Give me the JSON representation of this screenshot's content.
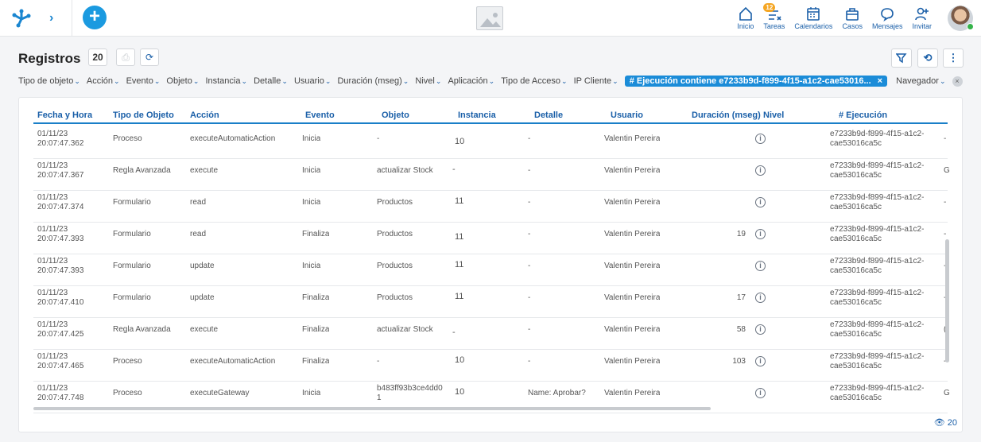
{
  "topbar": {
    "nav_items": [
      {
        "label": "Inicio",
        "icon": "home-icon"
      },
      {
        "label": "Tareas",
        "icon": "tasks-icon",
        "badge": "12"
      },
      {
        "label": "Calendarios",
        "icon": "calendar-icon"
      },
      {
        "label": "Casos",
        "icon": "briefcase-icon"
      },
      {
        "label": "Mensajes",
        "icon": "chat-icon"
      },
      {
        "label": "Invitar",
        "icon": "invite-user-icon"
      }
    ]
  },
  "page": {
    "title": "Registros",
    "count": "20",
    "footer_count": "20"
  },
  "filters": {
    "items": [
      "Tipo de objeto",
      "Acción",
      "Evento",
      "Objeto",
      "Instancia",
      "Detalle",
      "Usuario",
      "Duración (mseg)",
      "Nivel",
      "Aplicación",
      "Tipo de Acceso",
      "IP Cliente"
    ],
    "active_chip": "# Ejecución contiene e7233b9d-f899-4f15-a1c2-cae53016...",
    "after_chip": "Navegador"
  },
  "table": {
    "columns": [
      "Fecha y Hora",
      "Tipo de Objeto",
      "Acción",
      "Evento",
      "Objeto",
      "Instancia",
      "Detalle",
      "Usuario",
      "Duración (mseg)",
      "Nivel",
      "# Ejecución"
    ],
    "rows": [
      {
        "date": "01/11/23",
        "time": "20:07:47.362",
        "tipo": "Proceso",
        "accion": "executeAutomaticAction",
        "evento": "Inicia",
        "objeto": "-",
        "objeto2": "",
        "instancia": "10",
        "detalle": "-",
        "usuario": "Valentin Pereira",
        "duracion": "",
        "ejec1": "e7233b9d-f899-4f15-a1c2-",
        "ejec2": "cae53016ca5c",
        "extra": "-"
      },
      {
        "date": "01/11/23",
        "time": "20:07:47.367",
        "tipo": "Regla Avanzada",
        "accion": "execute",
        "evento": "Inicia",
        "objeto": "actualizar Stock",
        "objeto2": "",
        "instancia": "-",
        "detalle": "-",
        "usuario": "Valentin Pereira",
        "duracion": "",
        "ejec1": "e7233b9d-f899-4f15-a1c2-",
        "ejec2": "cae53016ca5c",
        "extra": "G"
      },
      {
        "date": "01/11/23",
        "time": "20:07:47.374",
        "tipo": "Formulario",
        "accion": "read",
        "evento": "Inicia",
        "objeto": "Productos",
        "objeto2": "",
        "instancia": "11",
        "detalle": "-",
        "usuario": "Valentin Pereira",
        "duracion": "",
        "ejec1": "e7233b9d-f899-4f15-a1c2-",
        "ejec2": "cae53016ca5c",
        "extra": "-"
      },
      {
        "date": "01/11/23",
        "time": "20:07:47.393",
        "tipo": "Formulario",
        "accion": "read",
        "evento": "Finaliza",
        "objeto": "Productos",
        "objeto2": "",
        "instancia": "11",
        "detalle": "-",
        "usuario": "Valentin Pereira",
        "duracion": "19",
        "ejec1": "e7233b9d-f899-4f15-a1c2-",
        "ejec2": "cae53016ca5c",
        "extra": "-"
      },
      {
        "date": "01/11/23",
        "time": "20:07:47.393",
        "tipo": "Formulario",
        "accion": "update",
        "evento": "Inicia",
        "objeto": "Productos",
        "objeto2": "",
        "instancia": "11",
        "detalle": "-",
        "usuario": "Valentin Pereira",
        "duracion": "",
        "ejec1": "e7233b9d-f899-4f15-a1c2-",
        "ejec2": "cae53016ca5c",
        "extra": "-"
      },
      {
        "date": "01/11/23",
        "time": "20:07:47.410",
        "tipo": "Formulario",
        "accion": "update",
        "evento": "Finaliza",
        "objeto": "Productos",
        "objeto2": "",
        "instancia": "11",
        "detalle": "-",
        "usuario": "Valentin Pereira",
        "duracion": "17",
        "ejec1": "e7233b9d-f899-4f15-a1c2-",
        "ejec2": "cae53016ca5c",
        "extra": "-"
      },
      {
        "date": "01/11/23",
        "time": "20:07:47.425",
        "tipo": "Regla Avanzada",
        "accion": "execute",
        "evento": "Finaliza",
        "objeto": "actualizar Stock",
        "objeto2": "",
        "instancia": "-",
        "detalle": "-",
        "usuario": "Valentin Pereira",
        "duracion": "58",
        "ejec1": "e7233b9d-f899-4f15-a1c2-",
        "ejec2": "cae53016ca5c",
        "extra": "("
      },
      {
        "date": "01/11/23",
        "time": "20:07:47.465",
        "tipo": "Proceso",
        "accion": "executeAutomaticAction",
        "evento": "Finaliza",
        "objeto": "-",
        "objeto2": "",
        "instancia": "10",
        "detalle": "-",
        "usuario": "Valentin Pereira",
        "duracion": "103",
        "ejec1": "e7233b9d-f899-4f15-a1c2-",
        "ejec2": "cae53016ca5c",
        "extra": "-"
      },
      {
        "date": "01/11/23",
        "time": "20:07:47.748",
        "tipo": "Proceso",
        "accion": "executeGateway",
        "evento": "Inicia",
        "objeto": "b483ff93b3ce4dd0",
        "objeto2": "1",
        "instancia": "10",
        "detalle": "Name: Aprobar?",
        "usuario": "Valentin Pereira",
        "duracion": "",
        "ejec1": "e7233b9d-f899-4f15-a1c2-",
        "ejec2": "cae53016ca5c",
        "extra": "G"
      }
    ]
  },
  "colors": {
    "accent": "#1b8cd8",
    "header_text": "#1a5fa8"
  }
}
